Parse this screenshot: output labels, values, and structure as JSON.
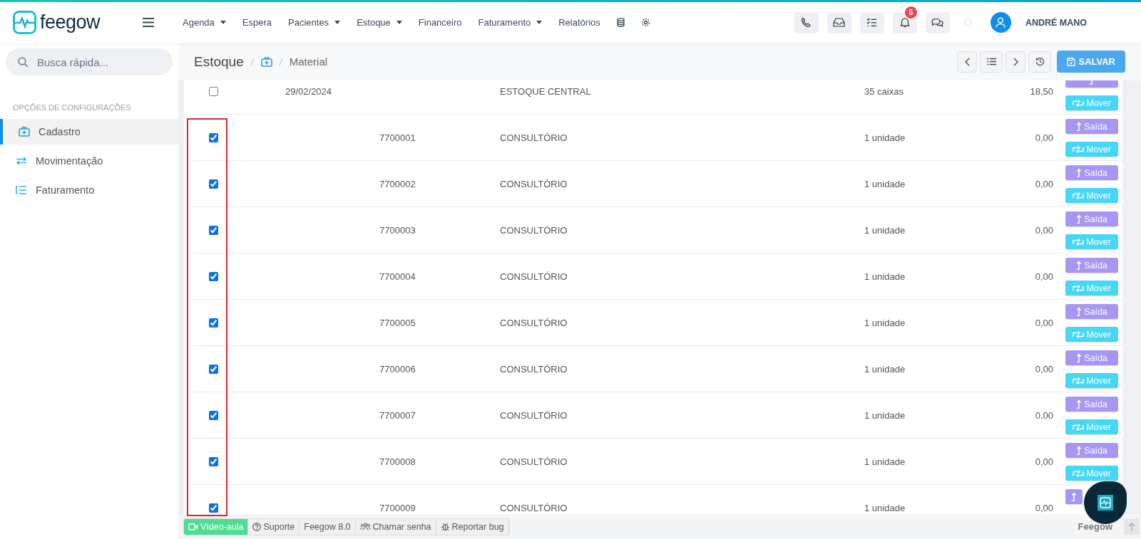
{
  "brand": {
    "name": "feegow"
  },
  "nav": [
    {
      "label": "Agenda",
      "dropdown": true
    },
    {
      "label": "Espera",
      "dropdown": false
    },
    {
      "label": "Pacientes",
      "dropdown": true
    },
    {
      "label": "Estoque",
      "dropdown": true
    },
    {
      "label": "Financeiro",
      "dropdown": false
    },
    {
      "label": "Faturamento",
      "dropdown": true
    },
    {
      "label": "Relatórios",
      "dropdown": false
    }
  ],
  "notifications": {
    "count": "5"
  },
  "user": {
    "name": "ANDRÉ MANO"
  },
  "search": {
    "placeholder": "Busca rápida..."
  },
  "sidebar": {
    "heading": "OPÇÕES DE CONFIGURAÇÕES",
    "items": [
      {
        "label": "Cadastro",
        "kind": "medkit",
        "selected": true
      },
      {
        "label": "Movimentação",
        "kind": "transfer",
        "selected": false
      },
      {
        "label": "Faturamento",
        "kind": "list",
        "selected": false
      }
    ]
  },
  "breadcrumb": {
    "section": "Estoque",
    "page": "Material"
  },
  "save_button": {
    "label": "SALVAR"
  },
  "rows": [
    {
      "checked": false,
      "date": "29/02/2024",
      "location": "ESTOQUE CENTRAL",
      "quantity": "35 caixas",
      "value": "18,50",
      "actions": [
        {
          "kind": "exit"
        },
        {
          "kind": "move",
          "label": "Mover"
        }
      ]
    },
    {
      "checked": true,
      "code": "7700001",
      "location": "CONSULTÓRIO",
      "quantity": "1 unidade",
      "value": "0,00",
      "actions": [
        {
          "kind": "exit",
          "label": "Saída"
        },
        {
          "kind": "move",
          "label": "Mover"
        }
      ]
    },
    {
      "checked": true,
      "code": "7700002",
      "location": "CONSULTÓRIO",
      "quantity": "1 unidade",
      "value": "0,00",
      "actions": [
        {
          "kind": "exit",
          "label": "Saída"
        },
        {
          "kind": "move",
          "label": "Mover"
        }
      ]
    },
    {
      "checked": true,
      "code": "7700003",
      "location": "CONSULTÓRIO",
      "quantity": "1 unidade",
      "value": "0,00",
      "actions": [
        {
          "kind": "exit",
          "label": "Saída"
        },
        {
          "kind": "move",
          "label": "Mover"
        }
      ]
    },
    {
      "checked": true,
      "code": "7700004",
      "location": "CONSULTÓRIO",
      "quantity": "1 unidade",
      "value": "0,00",
      "actions": [
        {
          "kind": "exit",
          "label": "Saída"
        },
        {
          "kind": "move",
          "label": "Mover"
        }
      ]
    },
    {
      "checked": true,
      "code": "7700005",
      "location": "CONSULTÓRIO",
      "quantity": "1 unidade",
      "value": "0,00",
      "actions": [
        {
          "kind": "exit",
          "label": "Saída"
        },
        {
          "kind": "move",
          "label": "Mover"
        }
      ]
    },
    {
      "checked": true,
      "code": "7700006",
      "location": "CONSULTÓRIO",
      "quantity": "1 unidade",
      "value": "0,00",
      "actions": [
        {
          "kind": "exit",
          "label": "Saída"
        },
        {
          "kind": "move",
          "label": "Mover"
        }
      ]
    },
    {
      "checked": true,
      "code": "7700007",
      "location": "CONSULTÓRIO",
      "quantity": "1 unidade",
      "value": "0,00",
      "actions": [
        {
          "kind": "exit",
          "label": "Saída"
        },
        {
          "kind": "move",
          "label": "Mover"
        }
      ]
    },
    {
      "checked": true,
      "code": "7700008",
      "location": "CONSULTÓRIO",
      "quantity": "1 unidade",
      "value": "0,00",
      "actions": [
        {
          "kind": "exit",
          "label": "Saída"
        },
        {
          "kind": "move",
          "label": "Mover"
        }
      ]
    },
    {
      "checked": true,
      "code": "7700009",
      "location": "CONSULTÓRIO",
      "quantity": "1 unidade",
      "value": "0,00",
      "actions": [
        {
          "kind": "exit"
        }
      ]
    }
  ],
  "footer": {
    "links": [
      {
        "label": "Vídeo-aula",
        "kind": "video"
      },
      {
        "label": "Suporte",
        "kind": "help"
      },
      {
        "label": "Feegow 8.0",
        "kind": "version"
      },
      {
        "label": "Chamar senha",
        "kind": "people"
      },
      {
        "label": "Reportar bug",
        "kind": "bug"
      }
    ],
    "brand": "Feegow"
  }
}
